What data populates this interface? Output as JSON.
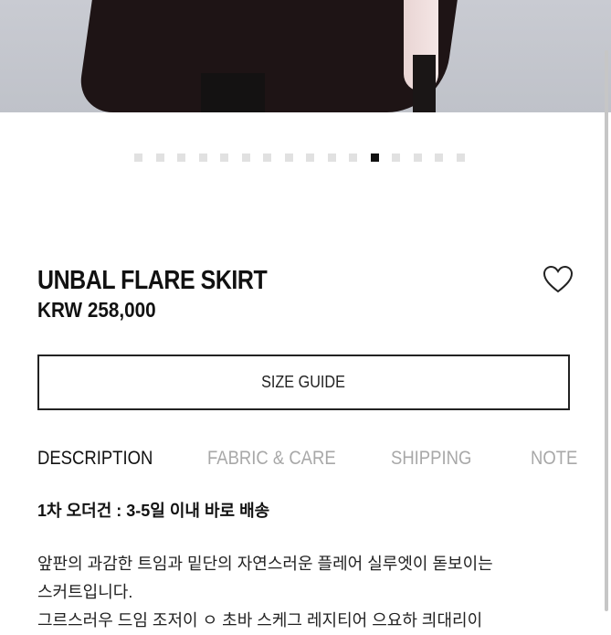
{
  "product": {
    "name": "UNBAL FLARE SKIRT",
    "price": "KRW 258,000"
  },
  "gallery": {
    "total_images": 16,
    "active_index": 11
  },
  "buttons": {
    "size_guide": "SIZE GUIDE"
  },
  "tabs": [
    {
      "label": "DESCRIPTION",
      "active": true
    },
    {
      "label": "FABRIC & CARE",
      "active": false
    },
    {
      "label": "SHIPPING",
      "active": false
    },
    {
      "label": "NOTE",
      "active": false
    }
  ],
  "description": {
    "shipping_note": "1차 오더건 : 3-5일 이내 바로 배송",
    "lines": [
      "앞판의 과감한 트임과 밑단의 자연스러운 플레어 실루엣이 돋보이는",
      "스커트입니다.",
      "그르스러우 드임 조저이 ㅇ 초바 스케그 레지티어 으요하 킈대리이"
    ]
  },
  "icons": {
    "wishlist": "heart-outline-icon"
  },
  "colors": {
    "text": "#111111",
    "inactive_tab": "#a8a8a8",
    "dot_inactive": "#e1e1e1",
    "dot_active": "#111111"
  }
}
